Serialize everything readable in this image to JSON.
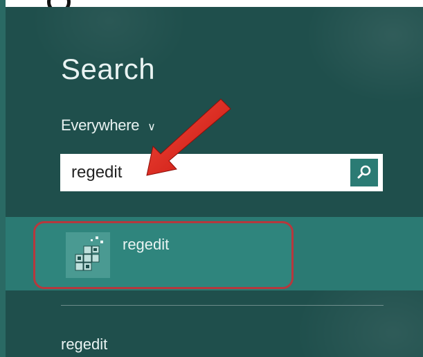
{
  "search": {
    "title": "Search",
    "scope_label": "Everywhere",
    "query": "regedit"
  },
  "results": [
    {
      "label": "regedit",
      "icon": "registry-editor-icon"
    }
  ],
  "suggestions": [
    {
      "label": "regedit"
    }
  ],
  "colors": {
    "background": "#1f4f4c",
    "result_band": "#2b7a73",
    "highlight_border": "#b6383d",
    "annotation_arrow": "#e0251b",
    "search_button": "#2b7b74"
  }
}
